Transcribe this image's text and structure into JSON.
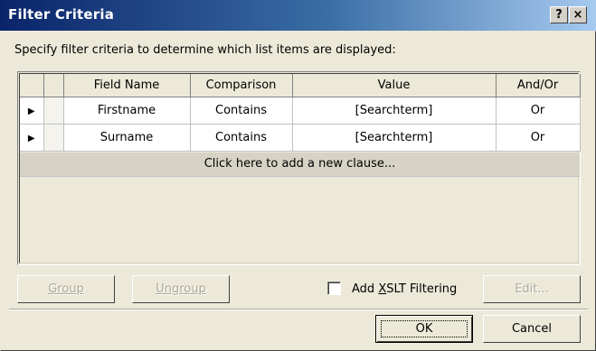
{
  "window": {
    "title": "Filter Criteria",
    "help_label": "?",
    "close_label": "×"
  },
  "instruction": "Specify filter criteria to determine which list items are displayed:",
  "table": {
    "columns": [
      "",
      "",
      "Field Name",
      "Comparison",
      "Value",
      "And/Or"
    ],
    "rows": [
      {
        "marker": "▶",
        "field": "Firstname",
        "comparison": "Contains",
        "value": "[Searchterm]",
        "andor": "Or"
      },
      {
        "marker": "▶",
        "field": "Surname",
        "comparison": "Contains",
        "value": "[Searchterm]",
        "andor": "Or"
      }
    ],
    "add_clause": "Click here to add a new clause..."
  },
  "buttons": {
    "group": "Group",
    "ungroup": "Ungroup",
    "edit": "Edit...",
    "ok": "OK",
    "cancel": "Cancel"
  },
  "xslt_checkbox": {
    "label_pre": "Add ",
    "label_accel": "X",
    "label_post": "SLT Filtering",
    "checked": false
  }
}
